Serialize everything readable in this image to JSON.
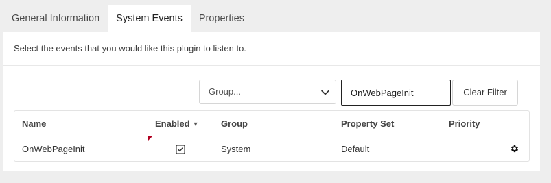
{
  "tabs": [
    {
      "label": "General Information",
      "active": false
    },
    {
      "label": "System Events",
      "active": true
    },
    {
      "label": "Properties",
      "active": false
    }
  ],
  "description": "Select the events that you would like this plugin to listen to.",
  "filters": {
    "group_select": {
      "value": "Group...",
      "icon": "chevron-down-icon"
    },
    "search_input": {
      "value": "OnWebPageInit"
    },
    "clear_label": "Clear Filter"
  },
  "grid": {
    "columns": [
      {
        "label": "Name"
      },
      {
        "label": "Enabled",
        "sorted": "descending"
      },
      {
        "label": "Group"
      },
      {
        "label": "Property Set"
      },
      {
        "label": "Priority"
      }
    ],
    "rows": [
      {
        "name": "OnWebPageInit",
        "enabled": true,
        "group": "System",
        "property_set": "Default",
        "priority": "",
        "dirty": true
      }
    ],
    "action_icon": "gear-icon"
  },
  "colors": {
    "page_bg": "#eeeeee",
    "panel_bg": "#ffffff",
    "dirty_flag": "#b00020"
  }
}
